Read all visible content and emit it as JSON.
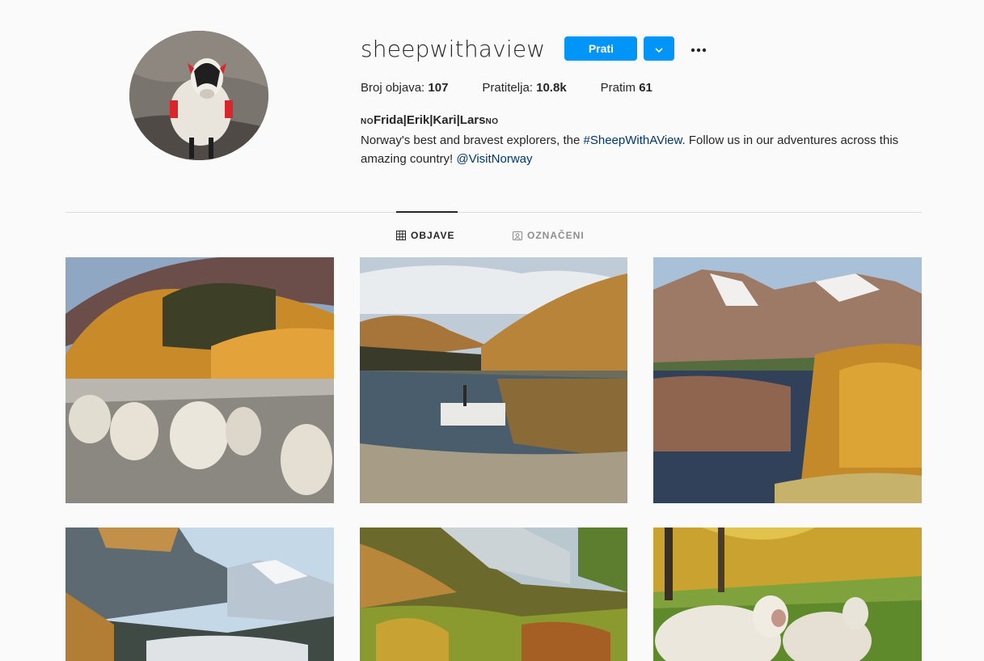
{
  "profile": {
    "username": "sheepwithaview",
    "follow_label": "Prati",
    "stats": {
      "posts_label": "Broj objava:",
      "posts_value": "107",
      "followers_label": "Pratitelja:",
      "followers_value": "10.8k",
      "following_label": "Pratim",
      "following_value": "61"
    },
    "bio": {
      "flag_left": "NO",
      "name": "Frida|Erik|Kari|Lars",
      "flag_right": "NO",
      "text_before": "Norway's best and bravest explorers, the ",
      "hashtag": "#SheepWithAView",
      "text_after": ". Follow us in our adventures across this amazing country! ",
      "mention": "@VisitNorway"
    }
  },
  "tabs": {
    "posts_label": "OBJAVE",
    "tagged_label": "OZNAČENI"
  },
  "colors": {
    "accent": "#0095f6",
    "link": "#00376b",
    "muted": "#8e8e8e",
    "divider": "#dbdbdb"
  },
  "icons": {
    "dropdown": "chevron-down-icon",
    "more": "more-horizontal-icon",
    "posts_tab": "grid-icon",
    "tagged_tab": "tagged-person-icon"
  }
}
